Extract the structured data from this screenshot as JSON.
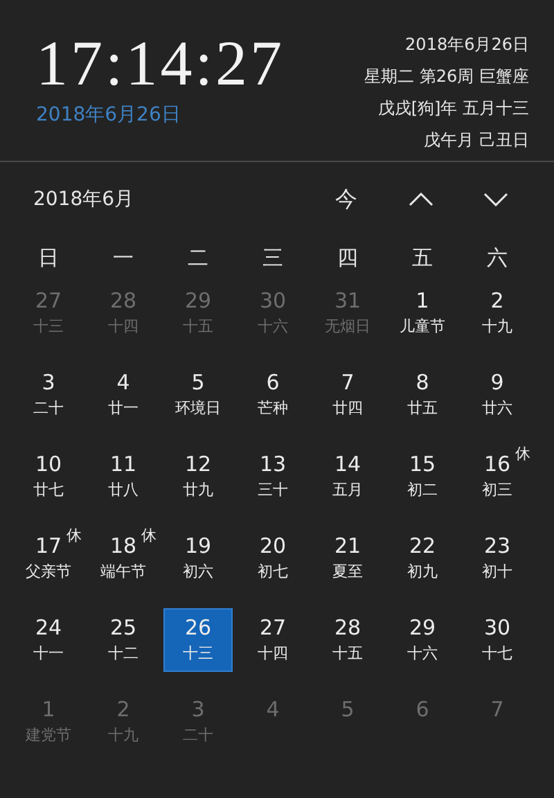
{
  "clock": {
    "time": "17:14:27",
    "date": "2018年6月26日"
  },
  "info": [
    "2018年6月26日",
    "星期二 第26周 巨蟹座",
    "戊戌[狗]年 五月十三",
    "戊午月 己丑日"
  ],
  "month_bar": {
    "title": "2018年6月",
    "today_button": "今"
  },
  "weekdays": [
    "日",
    "一",
    "二",
    "三",
    "四",
    "五",
    "六"
  ],
  "days": [
    {
      "day": "27",
      "lunar": "十三",
      "muted": true,
      "selected": false
    },
    {
      "day": "28",
      "lunar": "十四",
      "muted": true,
      "selected": false
    },
    {
      "day": "29",
      "lunar": "十五",
      "muted": true,
      "selected": false
    },
    {
      "day": "30",
      "lunar": "十六",
      "muted": true,
      "selected": false
    },
    {
      "day": "31",
      "lunar": "无烟日",
      "muted": true,
      "selected": false
    },
    {
      "day": "1",
      "lunar": "儿童节",
      "muted": false,
      "selected": false
    },
    {
      "day": "2",
      "lunar": "十九",
      "muted": false,
      "selected": false
    },
    {
      "day": "3",
      "lunar": "二十",
      "muted": false,
      "selected": false
    },
    {
      "day": "4",
      "lunar": "廿一",
      "muted": false,
      "selected": false
    },
    {
      "day": "5",
      "lunar": "环境日",
      "muted": false,
      "selected": false
    },
    {
      "day": "6",
      "lunar": "芒种",
      "muted": false,
      "selected": false
    },
    {
      "day": "7",
      "lunar": "廿四",
      "muted": false,
      "selected": false
    },
    {
      "day": "8",
      "lunar": "廿五",
      "muted": false,
      "selected": false
    },
    {
      "day": "9",
      "lunar": "廿六",
      "muted": false,
      "selected": false
    },
    {
      "day": "10",
      "lunar": "廿七",
      "muted": false,
      "selected": false
    },
    {
      "day": "11",
      "lunar": "廿八",
      "muted": false,
      "selected": false
    },
    {
      "day": "12",
      "lunar": "廿九",
      "muted": false,
      "selected": false
    },
    {
      "day": "13",
      "lunar": "三十",
      "muted": false,
      "selected": false
    },
    {
      "day": "14",
      "lunar": "五月",
      "muted": false,
      "selected": false
    },
    {
      "day": "15",
      "lunar": "初二",
      "muted": false,
      "selected": false
    },
    {
      "day": "16",
      "lunar": "初三",
      "muted": false,
      "selected": false,
      "badge": "休"
    },
    {
      "day": "17",
      "lunar": "父亲节",
      "muted": false,
      "selected": false,
      "badge": "休"
    },
    {
      "day": "18",
      "lunar": "端午节",
      "muted": false,
      "selected": false,
      "badge": "休"
    },
    {
      "day": "19",
      "lunar": "初六",
      "muted": false,
      "selected": false
    },
    {
      "day": "20",
      "lunar": "初七",
      "muted": false,
      "selected": false
    },
    {
      "day": "21",
      "lunar": "夏至",
      "muted": false,
      "selected": false
    },
    {
      "day": "22",
      "lunar": "初九",
      "muted": false,
      "selected": false
    },
    {
      "day": "23",
      "lunar": "初十",
      "muted": false,
      "selected": false
    },
    {
      "day": "24",
      "lunar": "十一",
      "muted": false,
      "selected": false
    },
    {
      "day": "25",
      "lunar": "十二",
      "muted": false,
      "selected": false
    },
    {
      "day": "26",
      "lunar": "十三",
      "muted": false,
      "selected": true
    },
    {
      "day": "27",
      "lunar": "十四",
      "muted": false,
      "selected": false
    },
    {
      "day": "28",
      "lunar": "十五",
      "muted": false,
      "selected": false
    },
    {
      "day": "29",
      "lunar": "十六",
      "muted": false,
      "selected": false
    },
    {
      "day": "30",
      "lunar": "十七",
      "muted": false,
      "selected": false
    },
    {
      "day": "1",
      "lunar": "建党节",
      "muted": true,
      "selected": false
    },
    {
      "day": "2",
      "lunar": "十九",
      "muted": true,
      "selected": false
    },
    {
      "day": "3",
      "lunar": "二十",
      "muted": true,
      "selected": false
    },
    {
      "day": "4",
      "muted": true,
      "selected": false
    },
    {
      "day": "5",
      "muted": true,
      "selected": false
    },
    {
      "day": "6",
      "muted": true,
      "selected": false
    },
    {
      "day": "7",
      "muted": true,
      "selected": false
    }
  ]
}
